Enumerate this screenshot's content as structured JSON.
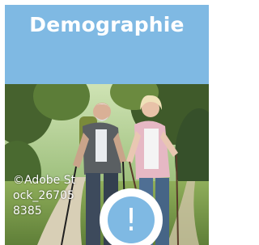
{
  "tile": {
    "title": "Demographie",
    "photo_credit": "©Adobe Stock_267058385",
    "badge_symbol": "!",
    "photo_subject": "hikers-photo"
  },
  "colors": {
    "accent": "#7fb9e3",
    "text_on_accent": "#ffffff"
  }
}
